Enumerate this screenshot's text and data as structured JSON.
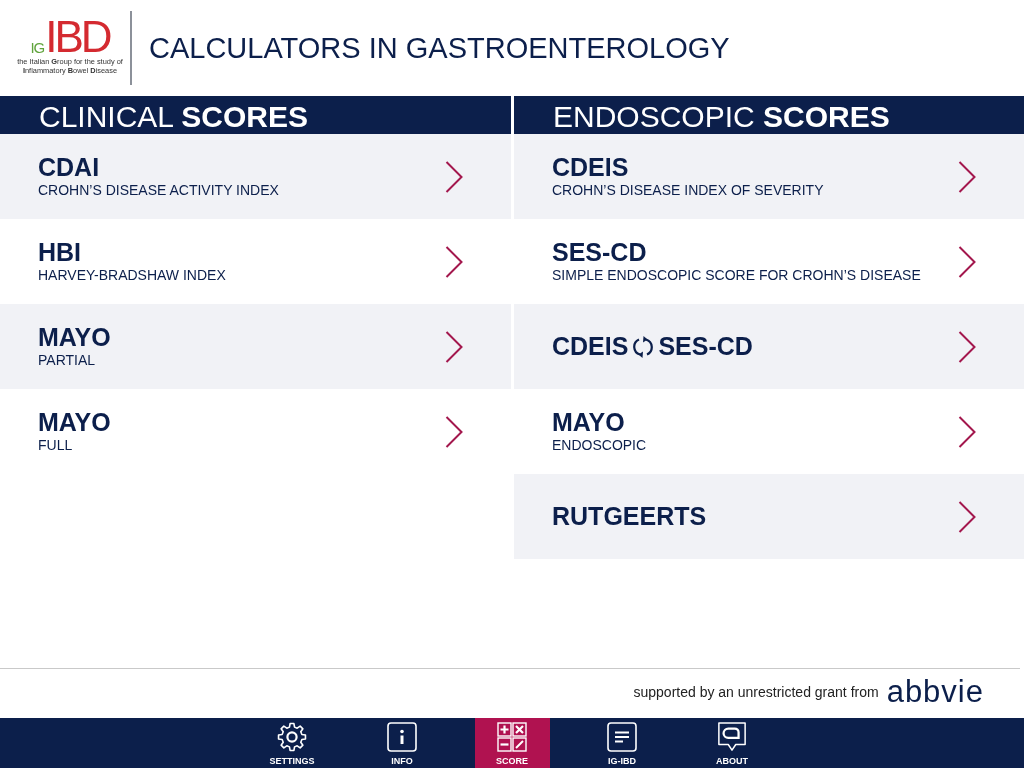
{
  "header": {
    "logo": {
      "letters_small": "IG",
      "letters_large": "IBD",
      "tagline": [
        "the Italian **G**roup for the study of",
        "**I**nflammatory **B**owel **D**isease"
      ]
    },
    "title": "CALCULATORS IN GASTROENTEROLOGY"
  },
  "columns": [
    {
      "heading": "CLINICAL **SCORES**",
      "items": [
        {
          "kind": "score",
          "title": "CDAI",
          "subtitle": "CROHN’S DISEASE ACTIVITY INDEX"
        },
        {
          "kind": "score",
          "title": "HBI",
          "subtitle": "HARVEY-BRADSHAW INDEX"
        },
        {
          "kind": "score",
          "title": "MAYO",
          "subtitle": "PARTIAL"
        },
        {
          "kind": "score",
          "title": "MAYO",
          "subtitle": "FULL"
        }
      ]
    },
    {
      "heading": "ENDOSCOPIC **SCORES**",
      "items": [
        {
          "kind": "score",
          "title": "CDEIS",
          "subtitle": "CROHN’S DISEASE INDEX OF SEVERITY"
        },
        {
          "kind": "score",
          "title": "SES-CD",
          "subtitle": "SIMPLE ENDOSCOPIC SCORE FOR CROHN’S DISEASE"
        },
        {
          "kind": "conversion",
          "title_left": "CDEIS",
          "title_right": "SES-CD"
        },
        {
          "kind": "score",
          "title": "MAYO",
          "subtitle": "ENDOSCOPIC"
        },
        {
          "kind": "score",
          "title": "RUTGEERTS"
        }
      ]
    }
  ],
  "sponsor": {
    "text": "supported by an unrestricted grant from",
    "logo": "abbvie"
  },
  "tab_bar": [
    {
      "kind": "settings",
      "label": "SETTINGS",
      "selected": false
    },
    {
      "kind": "info",
      "label": "INFO",
      "selected": false
    },
    {
      "kind": "score",
      "label": "SCORE",
      "selected": true
    },
    {
      "kind": "group",
      "label": "IG-IBD",
      "selected": false
    },
    {
      "kind": "about",
      "label": "ABOUT",
      "selected": false
    }
  ]
}
